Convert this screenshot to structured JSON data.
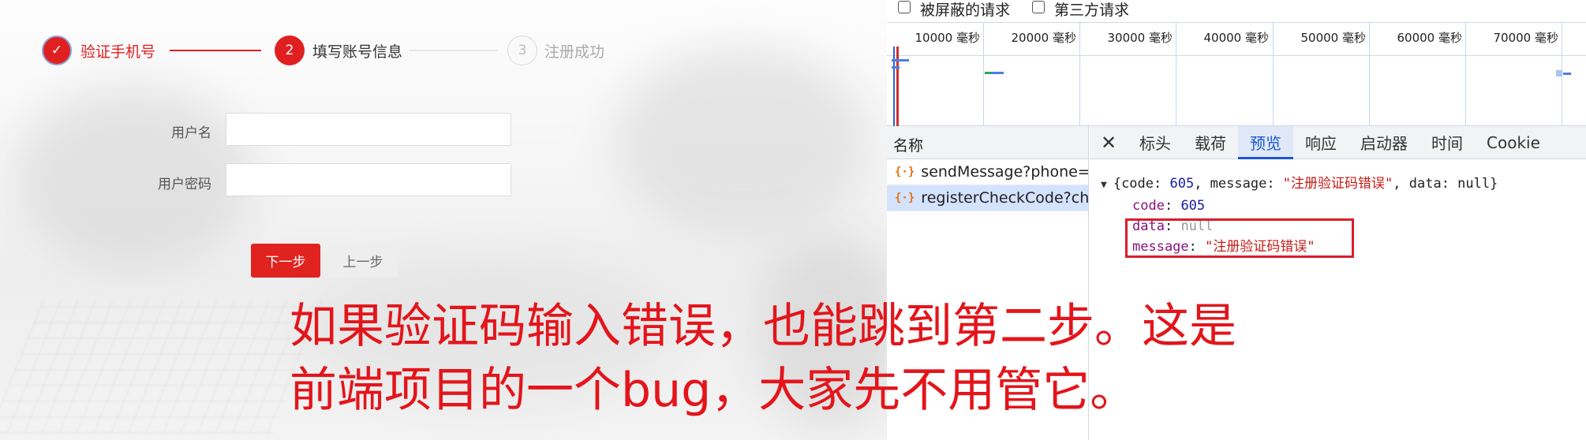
{
  "steps": [
    {
      "number": "✓",
      "label": "验证手机号"
    },
    {
      "number": "2",
      "label": "填写账号信息"
    },
    {
      "number": "3",
      "label": "注册成功"
    }
  ],
  "form": {
    "username_label": "用户名",
    "username_value": "",
    "password_label": "用户密码",
    "password_value": "",
    "next_button": "下一步",
    "prev_button": "上一步"
  },
  "devtools": {
    "filters": {
      "blocked_requests": "被屏蔽的请求",
      "third_party": "第三方请求"
    },
    "timeline_ticks": [
      "10000 毫秒",
      "20000 毫秒",
      "30000 毫秒",
      "40000 毫秒",
      "50000 毫秒",
      "60000 毫秒",
      "70000 毫秒"
    ],
    "name_column": "名称",
    "requests": [
      {
        "name": "sendMessage?phone=...",
        "selected": false
      },
      {
        "name": "registerCheckCode?ch...",
        "selected": true
      }
    ],
    "tabs": [
      "标头",
      "载荷",
      "预览",
      "响应",
      "启动器",
      "时间",
      "Cookie"
    ],
    "active_tab": "预览",
    "preview": {
      "summary_open": "{code: ",
      "summary_code": "605",
      "summary_mid": ", message: ",
      "summary_message": "\"注册验证码错误\"",
      "summary_mid2": ", data: ",
      "summary_null": "null",
      "summary_close": "}",
      "code_key": "code",
      "code_value": "605",
      "data_key": "data",
      "data_value": "null",
      "message_key": "message",
      "message_value": "\"注册验证码错误\""
    }
  },
  "caption": {
    "line1": "如果验证码输入错误，也能跳到第二步。这是",
    "line2": "前端项目的一个bug，大家先不用管它。"
  }
}
